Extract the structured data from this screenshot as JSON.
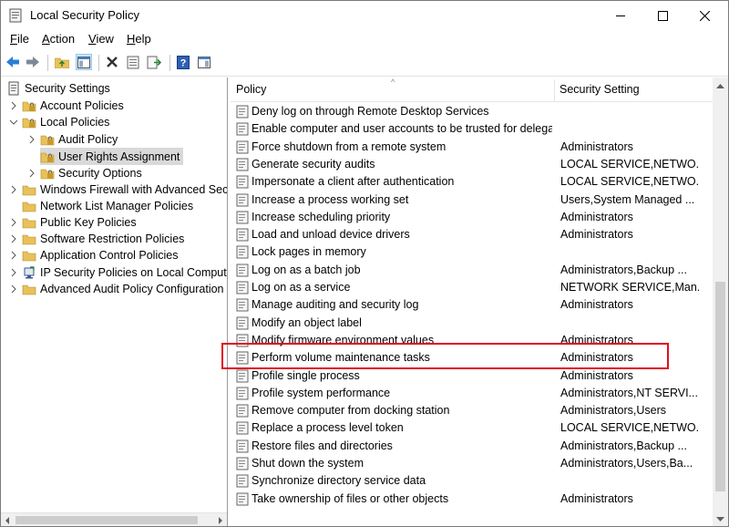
{
  "window": {
    "title": "Local Security Policy",
    "controls": [
      "minimize",
      "maximize",
      "close"
    ]
  },
  "menu": [
    {
      "label": "File",
      "accel": "F",
      "rest": "ile"
    },
    {
      "label": "Action",
      "accel": "A",
      "rest": "ction"
    },
    {
      "label": "View",
      "accel": "V",
      "rest": "iew"
    },
    {
      "label": "Help",
      "accel": "H",
      "rest": "elp"
    }
  ],
  "toolbar": {
    "icons": [
      "back-arrow-icon",
      "forward-arrow-icon",
      "up-folder-icon",
      "show-hide-tree-icon",
      "delete-icon",
      "properties-icon",
      "export-list-icon",
      "help-icon",
      "show-hide-action-pane-icon"
    ]
  },
  "tree": {
    "root": "Security Settings",
    "items": [
      {
        "label": "Account Policies"
      },
      {
        "label": "Local Policies"
      },
      {
        "label": "Audit Policy"
      },
      {
        "label": "User Rights Assignment"
      },
      {
        "label": "Security Options"
      },
      {
        "label": "Windows Firewall with Advanced Secu"
      },
      {
        "label": "Network List Manager Policies"
      },
      {
        "label": "Public Key Policies"
      },
      {
        "label": "Software Restriction Policies"
      },
      {
        "label": "Application Control Policies"
      },
      {
        "label": "IP Security Policies on Local Compute"
      },
      {
        "label": "Advanced Audit Policy Configuration"
      }
    ]
  },
  "list": {
    "headers": {
      "policy": "Policy",
      "setting": "Security Setting"
    },
    "rows": [
      {
        "policy": "Deny log on through Remote Desktop Services",
        "setting": ""
      },
      {
        "policy": "Enable computer and user accounts to be trusted for delega...",
        "setting": ""
      },
      {
        "policy": "Force shutdown from a remote system",
        "setting": "Administrators"
      },
      {
        "policy": "Generate security audits",
        "setting": "LOCAL SERVICE,NETWO..."
      },
      {
        "policy": "Impersonate a client after authentication",
        "setting": "LOCAL SERVICE,NETWO..."
      },
      {
        "policy": "Increase a process working set",
        "setting": "Users,System Managed ..."
      },
      {
        "policy": "Increase scheduling priority",
        "setting": "Administrators"
      },
      {
        "policy": "Load and unload device drivers",
        "setting": "Administrators"
      },
      {
        "policy": "Lock pages in memory",
        "setting": ""
      },
      {
        "policy": "Log on as a batch job",
        "setting": "Administrators,Backup ..."
      },
      {
        "policy": "Log on as a service",
        "setting": "NETWORK SERVICE,Man..."
      },
      {
        "policy": "Manage auditing and security log",
        "setting": "Administrators"
      },
      {
        "policy": "Modify an object label",
        "setting": ""
      },
      {
        "policy": "Modify firmware environment values",
        "setting": "Administrators"
      },
      {
        "policy": "Perform volume maintenance tasks",
        "setting": "Administrators"
      },
      {
        "policy": "Profile single process",
        "setting": "Administrators"
      },
      {
        "policy": "Profile system performance",
        "setting": "Administrators,NT SERVI..."
      },
      {
        "policy": "Remove computer from docking station",
        "setting": "Administrators,Users"
      },
      {
        "policy": "Replace a process level token",
        "setting": "LOCAL SERVICE,NETWO..."
      },
      {
        "policy": "Restore files and directories",
        "setting": "Administrators,Backup ..."
      },
      {
        "policy": "Shut down the system",
        "setting": "Administrators,Users,Ba..."
      },
      {
        "policy": "Synchronize directory service data",
        "setting": ""
      },
      {
        "policy": "Take ownership of files or other objects",
        "setting": "Administrators"
      }
    ]
  },
  "colors": {
    "highlight": "#e0101b",
    "selection": "#d9d9d9",
    "folder": "#e8c15a"
  }
}
